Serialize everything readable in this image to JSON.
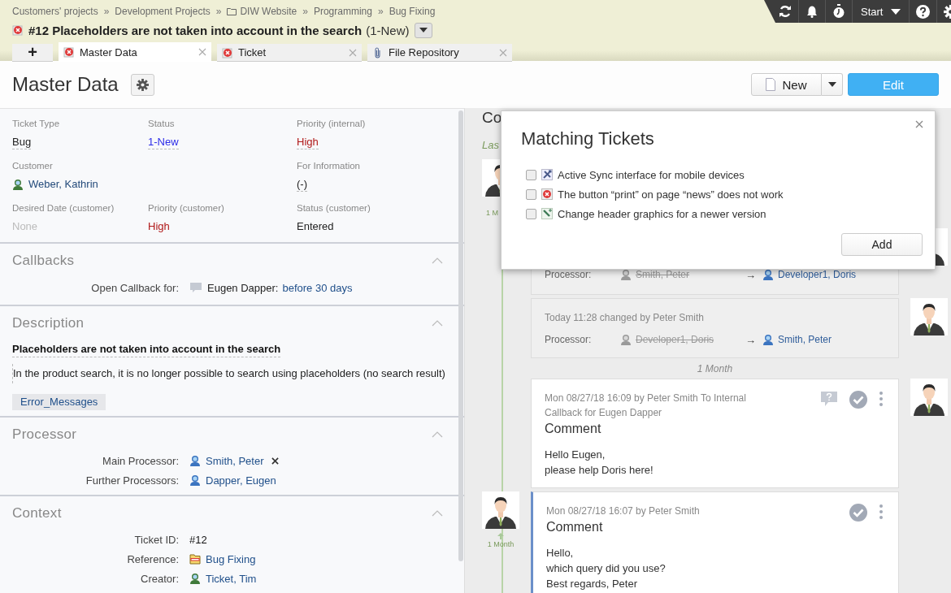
{
  "breadcrumb": [
    {
      "kind": "link",
      "label": "Customers' projects"
    },
    {
      "kind": "separator",
      "label": "»"
    },
    {
      "kind": "link",
      "label": "Development Projects"
    },
    {
      "kind": "separator",
      "label": "»"
    },
    {
      "kind": "folder",
      "label": "DIW Website"
    },
    {
      "kind": "separator",
      "label": "»"
    },
    {
      "kind": "link",
      "label": "Programming"
    },
    {
      "kind": "separator",
      "label": "»"
    },
    {
      "kind": "link",
      "label": "Bug Fixing"
    }
  ],
  "ticket": {
    "title": "#12 Placeholders are not taken into account in the search",
    "status": "(1-New)"
  },
  "tabs": [
    {
      "kind": "add",
      "label": "+",
      "selected": false
    },
    {
      "kind": "ticket",
      "label": "Master Data",
      "selected": true
    },
    {
      "kind": "ticket",
      "label": "Ticket",
      "selected": false
    },
    {
      "kind": "file",
      "label": "File Repository",
      "selected": false
    }
  ],
  "toolbar": {
    "start": "Start"
  },
  "page": {
    "title": "Master Data",
    "new_button": "New",
    "edit_button": "Edit"
  },
  "fields": [
    {
      "label": "Ticket Type",
      "value": "Bug",
      "kind": "plain",
      "editable": true,
      "wide": false
    },
    {
      "label": "Status",
      "value": "1-New",
      "kind": "link",
      "editable": true,
      "wide": false
    },
    {
      "label": "Priority (internal)",
      "value": "High",
      "kind": "high",
      "editable": true,
      "wide": false
    },
    {
      "label": "Customer",
      "value": "Weber, Kathrin",
      "kind": "customer",
      "editable": false,
      "wide": true
    },
    {
      "label": "For Information",
      "value": "(-)",
      "kind": "plain",
      "editable": true,
      "wide": false
    },
    {
      "label": "Desired Date (customer)",
      "value": "None",
      "kind": "muted",
      "editable": false,
      "wide": false
    },
    {
      "label": "Priority (customer)",
      "value": "High",
      "kind": "high",
      "editable": false,
      "wide": false
    },
    {
      "label": "Status (customer)",
      "value": "Entered",
      "kind": "plain",
      "editable": false,
      "wide": false
    }
  ],
  "sections": [
    {
      "kind": "callbacks",
      "title": "Callbacks",
      "expanded": true,
      "label": "Open Callback for:",
      "name": "Eugen Dapper:",
      "due": "before 30 days"
    },
    {
      "kind": "description",
      "title": "Description",
      "expanded": true,
      "heading": "Placeholders are not taken into account in the search",
      "text": "In the product search, it is no longer possible to search using placeholders (no search result)",
      "tags": [
        "Error_Messages"
      ]
    },
    {
      "kind": "rows",
      "title": "Processor",
      "expanded": true,
      "rows": [
        {
          "label": "Main Processor:",
          "value": "Smith, Peter",
          "kind": "user",
          "removable": true
        },
        {
          "label": "Further Processors:",
          "value": "Dapper, Eugen",
          "kind": "user",
          "removable": false
        }
      ]
    },
    {
      "kind": "rows",
      "title": "Context",
      "expanded": true,
      "rows": [
        {
          "label": "Ticket ID:",
          "value": "#12",
          "kind": "plain",
          "removable": false
        },
        {
          "label": "Reference:",
          "value": "Bug Fixing",
          "kind": "folder",
          "removable": false
        },
        {
          "label": "Creator:",
          "value": "Ticket, Tim",
          "kind": "customer",
          "removable": false
        }
      ]
    }
  ],
  "timeline": {
    "heading": "Co",
    "last": "Las",
    "lead_age": "1 M",
    "entries": [
      {
        "kind": "change",
        "own": false,
        "changes": [
          {
            "label": "Processor:",
            "old": "Smith, Peter",
            "arrow": "→",
            "new": "Developer1, Doris"
          }
        ]
      },
      {
        "kind": "change",
        "own": false,
        "meta": "Today 11:28 changed by Peter Smith",
        "changes": [
          {
            "label": "Processor:",
            "old": "Developer1, Doris",
            "arrow": "→",
            "new": "Smith, Peter"
          }
        ]
      },
      {
        "kind": "divider",
        "label": "1 Month"
      },
      {
        "kind": "comment",
        "own": false,
        "meta": "Mon 08/27/18 16:09 by Peter Smith To Internal",
        "callback": "Callback for Eugen Dapper",
        "title": "Comment",
        "lines": [
          "Hello Eugen,",
          "please help Doris here!"
        ]
      },
      {
        "kind": "comment",
        "own": true,
        "age": "1 Month",
        "meta": "Mon 08/27/18 16:07 by Peter Smith",
        "title": "Comment",
        "lines": [
          "Hello,",
          "which query did you use?",
          "Best regards, Peter"
        ]
      }
    ]
  },
  "modal": {
    "title": "Matching Tickets",
    "items": [
      {
        "kind": "feature",
        "label": "Active Sync interface for mobile devices",
        "checked": false
      },
      {
        "kind": "bug",
        "label": "The button “print” on page “news” does not work",
        "checked": false
      },
      {
        "kind": "change",
        "label": "Change header graphics for a newer version",
        "checked": false
      }
    ],
    "button": "Add"
  }
}
